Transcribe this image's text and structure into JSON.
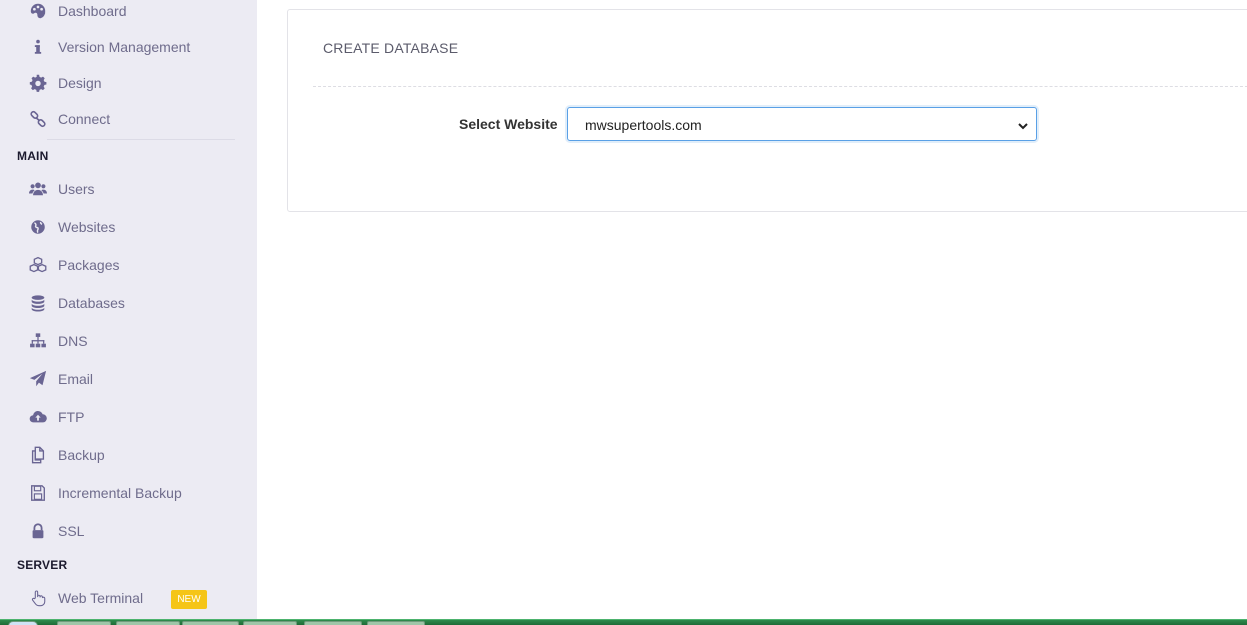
{
  "sidebar": {
    "top_items": [
      {
        "label": "Dashboard",
        "icon": "palette-icon"
      },
      {
        "label": "Version Management",
        "icon": "info-icon"
      },
      {
        "label": "Design",
        "icon": "gear-icon"
      },
      {
        "label": "Connect",
        "icon": "link-icon"
      }
    ],
    "main_title": "MAIN",
    "main_items": [
      {
        "label": "Users",
        "icon": "users-icon"
      },
      {
        "label": "Websites",
        "icon": "globe-icon"
      },
      {
        "label": "Packages",
        "icon": "cubes-icon"
      },
      {
        "label": "Databases",
        "icon": "database-icon"
      },
      {
        "label": "DNS",
        "icon": "sitemap-icon"
      },
      {
        "label": "Email",
        "icon": "paper-plane-icon"
      },
      {
        "label": "FTP",
        "icon": "cloud-upload-icon"
      },
      {
        "label": "Backup",
        "icon": "copy-icon"
      },
      {
        "label": "Incremental Backup",
        "icon": "floppy-disk-icon"
      },
      {
        "label": "SSL",
        "icon": "lock-icon"
      }
    ],
    "server_title": "SERVER",
    "server_items": [
      {
        "label": "Web Terminal",
        "icon": "hand-pointer-icon",
        "badge": "NEW"
      }
    ]
  },
  "panel": {
    "title": "CREATE DATABASE",
    "select_label": "Select Website",
    "select_value": "mwsupertools.com"
  },
  "colors": {
    "sidebar_bg": "#ecebf3",
    "icon_color": "#6a6593",
    "badge_bg": "#f5c518",
    "select_focus": "#5aa0e6",
    "taskbar": "#2d8b4d"
  }
}
